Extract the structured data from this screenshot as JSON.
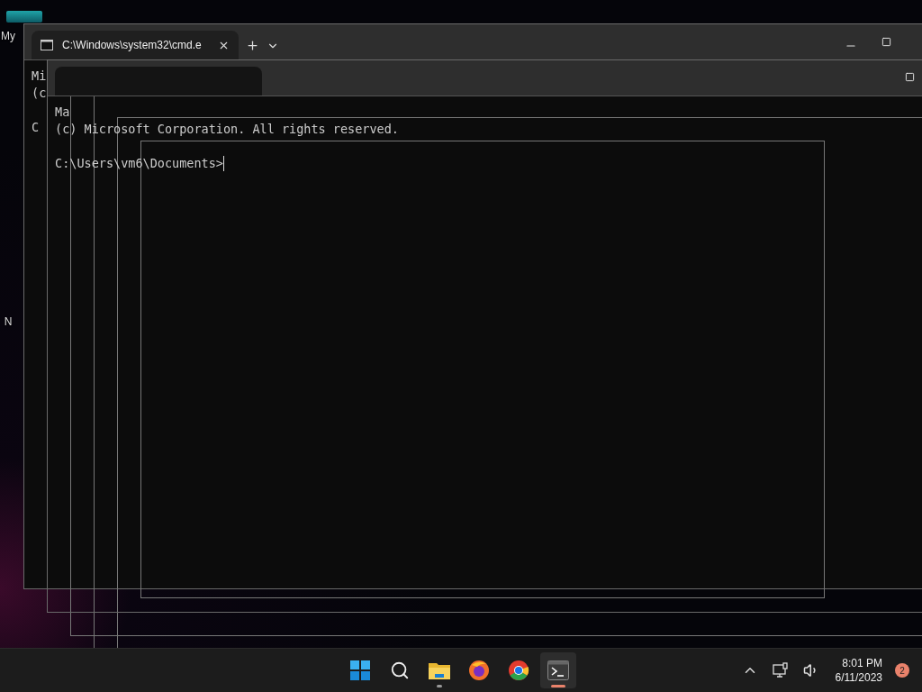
{
  "desktop": {
    "icons": [
      {
        "label": "My"
      },
      {
        "label": "N"
      }
    ]
  },
  "windows": [
    {
      "kind": "tabbed",
      "tab_title": "C:\\Windows\\system32\\cmd.e",
      "lines": [
        "Mi",
        "(c"
      ],
      "prompt": "C"
    },
    {
      "kind": "blank",
      "lines": [
        "Ma",
        "(c) Microsoft Corporation. All rights reserved."
      ],
      "prompt": "C:\\Users\\vm6\\Documents>",
      "cursor": true
    }
  ],
  "taskbar": {
    "apps": [
      {
        "kind": "start",
        "running": false,
        "selected": false
      },
      {
        "kind": "search",
        "running": false,
        "selected": false
      },
      {
        "kind": "folder",
        "running": true,
        "selected": false
      },
      {
        "kind": "firefox",
        "running": false,
        "selected": false
      },
      {
        "kind": "chrome",
        "running": false,
        "selected": false
      },
      {
        "kind": "terminal",
        "running": true,
        "selected": true
      }
    ],
    "time": "8:01 PM",
    "date": "6/11/2023",
    "notifications": "2"
  }
}
